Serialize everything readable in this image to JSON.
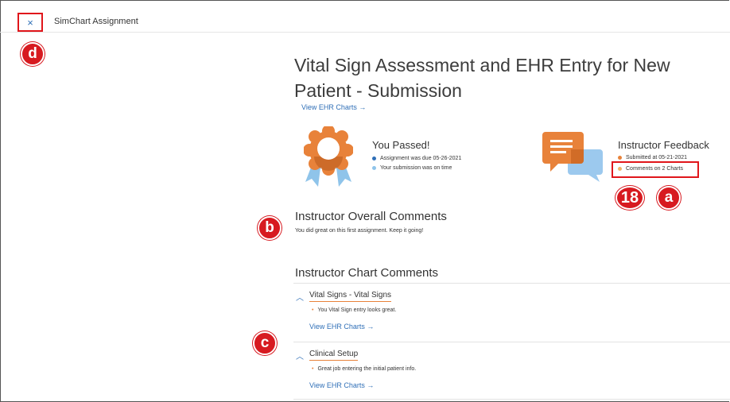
{
  "topbar": {
    "close_icon": "×",
    "app_title": "SimChart Assignment"
  },
  "markers": {
    "d": "d",
    "b": "b",
    "c": "c",
    "a": "a",
    "step": "18"
  },
  "main": {
    "title": "Vital Sign Assessment and EHR Entry for New Patient - Submission",
    "view_ehr_link": "View EHR Charts →",
    "passed": {
      "title": "You Passed!",
      "due": "Assignment was due 05-26-2021",
      "on_time": "Your submission was on time"
    },
    "feedback": {
      "title": "Instructor Feedback",
      "submitted": "Submitted at 05-21-2021",
      "comments": "Comments on 2 Charts"
    },
    "overall": {
      "title": "Instructor Overall Comments",
      "text": "You did great on this first assignment. Keep it going!"
    },
    "chart_comments": {
      "title": "Instructor Chart Comments",
      "items": [
        {
          "name": "Vital Signs - Vital Signs",
          "comment": "You Vital Sign entry looks great.",
          "link": "View EHR Charts →"
        },
        {
          "name": "Clinical Setup",
          "comment": "Great job entering the initial patient info.",
          "link": "View EHR Charts →"
        }
      ]
    }
  },
  "colors": {
    "accent_blue": "#2f6fb7",
    "accent_orange": "#e8823a",
    "marker_red": "#d71a20"
  }
}
